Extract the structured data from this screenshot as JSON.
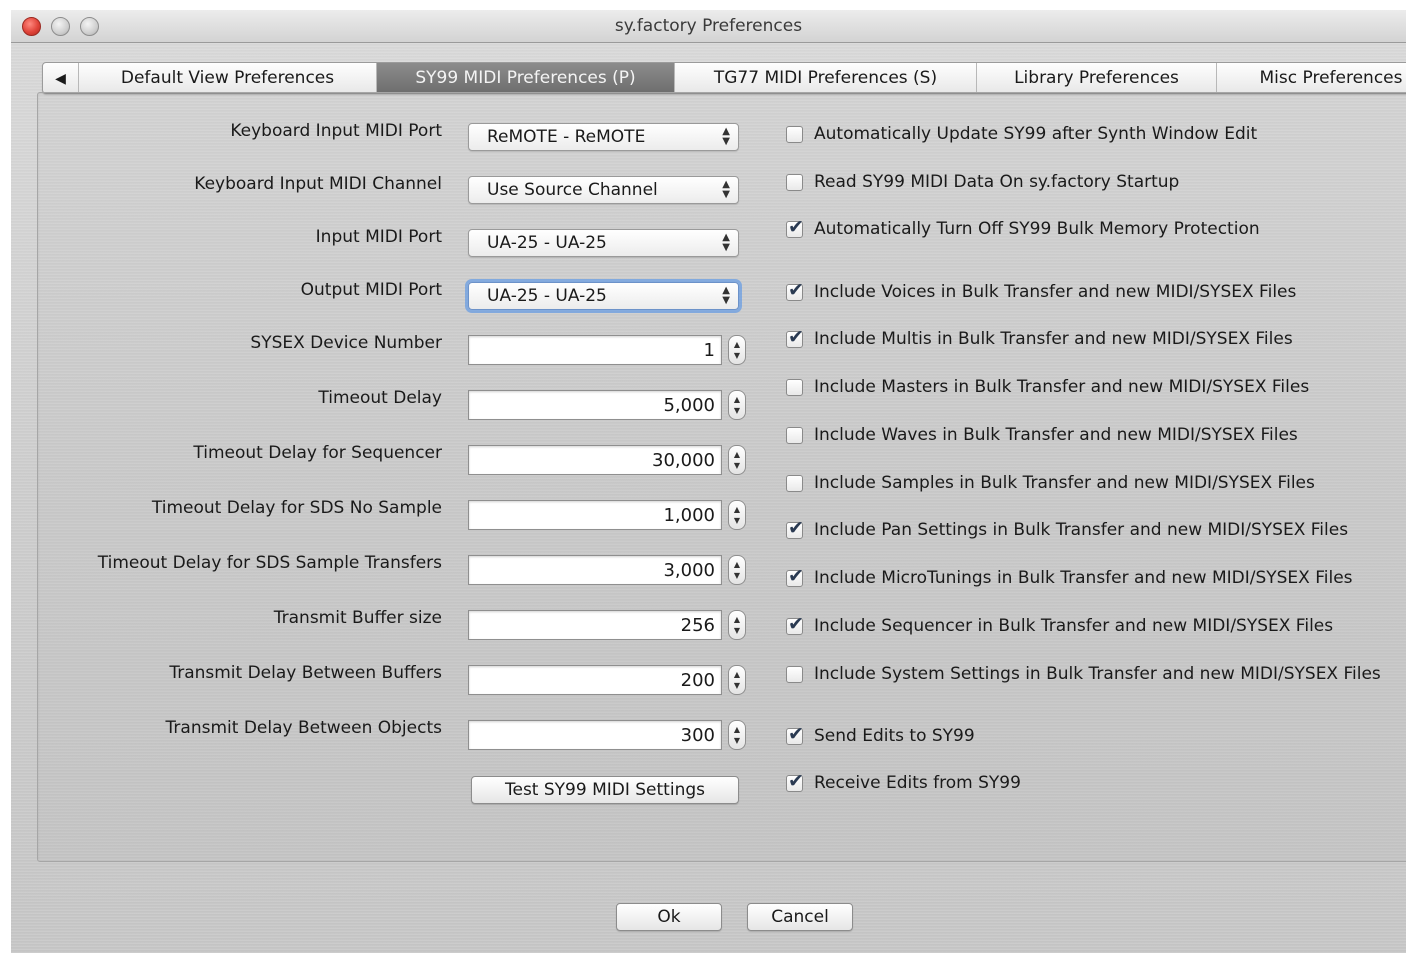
{
  "window": {
    "title": "sy.factory Preferences"
  },
  "tabs": {
    "scroll_left": "◀",
    "items": [
      "Default View Preferences",
      "SY99 MIDI Preferences (P)",
      "TG77 MIDI Preferences (S)",
      "Library Preferences",
      "Misc Preferences"
    ],
    "active": "SY99 MIDI Preferences (P)"
  },
  "form": {
    "keyboard_input_port": {
      "label": "Keyboard Input MIDI Port",
      "value": "ReMOTE - ReMOTE"
    },
    "keyboard_input_channel": {
      "label": "Keyboard Input MIDI Channel",
      "value": "Use Source Channel"
    },
    "input_port": {
      "label": "Input MIDI Port",
      "value": "UA-25 - UA-25"
    },
    "output_port": {
      "label": "Output MIDI Port",
      "value": "UA-25 - UA-25"
    },
    "sysex_device": {
      "label": "SYSEX Device Number",
      "value": "1"
    },
    "timeout_delay": {
      "label": "Timeout Delay",
      "value": "5,000"
    },
    "timeout_sequencer": {
      "label": "Timeout Delay for Sequencer",
      "value": "30,000"
    },
    "timeout_sds_no_sample": {
      "label": "Timeout Delay for SDS No Sample",
      "value": "1,000"
    },
    "timeout_sds_transfers": {
      "label": "Timeout Delay for SDS Sample Transfers",
      "value": "3,000"
    },
    "transmit_buffer": {
      "label": "Transmit Buffer size",
      "value": "256"
    },
    "transmit_delay_buffers": {
      "label": "Transmit Delay Between Buffers",
      "value": "200"
    },
    "transmit_delay_objects": {
      "label": "Transmit Delay Between Objects",
      "value": "300"
    },
    "test_button": "Test SY99 MIDI Settings"
  },
  "options": [
    {
      "label": "Automatically Update SY99 after Synth Window Edit",
      "checked": false
    },
    {
      "label": "Read SY99 MIDI Data On sy.factory Startup",
      "checked": false
    },
    {
      "label": "Automatically Turn Off SY99 Bulk Memory Protection",
      "checked": true
    },
    {
      "label": "Include Voices in Bulk Transfer and new MIDI/SYSEX Files",
      "checked": true
    },
    {
      "label": "Include Multis in Bulk Transfer and new MIDI/SYSEX Files",
      "checked": true
    },
    {
      "label": "Include Masters in Bulk Transfer and new MIDI/SYSEX Files",
      "checked": false
    },
    {
      "label": "Include Waves in Bulk Transfer and new MIDI/SYSEX Files",
      "checked": false
    },
    {
      "label": "Include Samples in Bulk Transfer and new MIDI/SYSEX Files",
      "checked": false
    },
    {
      "label": "Include Pan Settings in Bulk Transfer and new MIDI/SYSEX Files",
      "checked": true
    },
    {
      "label": "Include MicroTunings in Bulk Transfer and new MIDI/SYSEX Files",
      "checked": true
    },
    {
      "label": "Include Sequencer in Bulk Transfer and new MIDI/SYSEX Files",
      "checked": true
    },
    {
      "label": "Include System Settings in Bulk Transfer and new MIDI/SYSEX Files",
      "checked": false
    },
    {
      "label": "Send Edits to SY99",
      "checked": true
    },
    {
      "label": "Receive Edits from SY99",
      "checked": true
    }
  ],
  "footer": {
    "ok_label": "Ok",
    "cancel_label": "Cancel"
  },
  "glyphs": {
    "check": "✔",
    "up": "▲",
    "down": "▼"
  },
  "colors": {
    "active_tab": "#7d7d7d",
    "focus_ring": "#5a96e6",
    "close_button": "#e0443a"
  }
}
